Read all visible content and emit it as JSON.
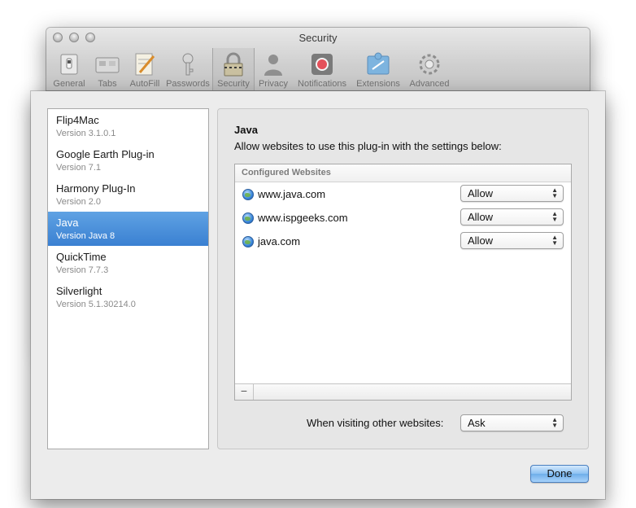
{
  "window": {
    "title": "Security"
  },
  "toolbar": {
    "items": [
      {
        "label": "General",
        "icon": "general-switch-icon"
      },
      {
        "label": "Tabs",
        "icon": "tabs-icon"
      },
      {
        "label": "AutoFill",
        "icon": "autofill-pencil-icon"
      },
      {
        "label": "Passwords",
        "icon": "key-icon"
      },
      {
        "label": "Security",
        "icon": "padlock-icon",
        "selected": true
      },
      {
        "label": "Privacy",
        "icon": "person-silhouette-icon"
      },
      {
        "label": "Notifications",
        "icon": "notifications-icon"
      },
      {
        "label": "Extensions",
        "icon": "puzzle-piece-icon"
      },
      {
        "label": "Advanced",
        "icon": "gear-icon"
      }
    ]
  },
  "plugins": [
    {
      "name": "Flip4Mac",
      "version": "Version 3.1.0.1"
    },
    {
      "name": "Google Earth Plug-in",
      "version": "Version 7.1"
    },
    {
      "name": "Harmony Plug-In",
      "version": "Version 2.0"
    },
    {
      "name": "Java",
      "version": "Version Java 8",
      "selected": true
    },
    {
      "name": "QuickTime",
      "version": "Version 7.7.3"
    },
    {
      "name": "Silverlight",
      "version": "Version 5.1.30214.0"
    }
  ],
  "detail": {
    "title": "Java",
    "description": "Allow websites to use this plug-in with the settings below:",
    "table_header": "Configured Websites",
    "sites": [
      {
        "domain": "www.java.com",
        "setting": "Allow"
      },
      {
        "domain": "www.ispgeeks.com",
        "setting": "Allow"
      },
      {
        "domain": "java.com",
        "setting": "Allow"
      }
    ],
    "remove_label": "−",
    "other_label": "When visiting other websites:",
    "other_setting": "Ask"
  },
  "buttons": {
    "done_label": "Done"
  },
  "colors": {
    "selection": "#3a80d2",
    "done_button": "#8cc1f3"
  }
}
